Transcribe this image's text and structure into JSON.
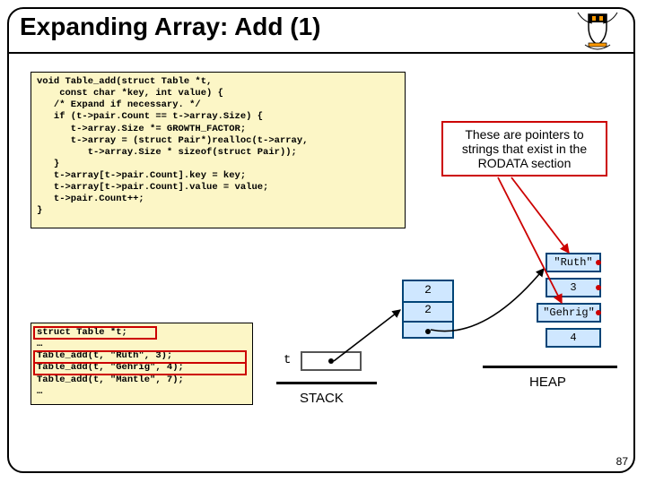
{
  "title": "Expanding Array: Add (1)",
  "code_main": "void Table_add(struct Table *t,\n    const char *key, int value) {\n   /* Expand if necessary. */\n   if (t->pair.Count == t->array.Size) {\n      t->array.Size *= GROWTH_FACTOR;\n      t->array = (struct Pair*)realloc(t->array,\n         t->array.Size * sizeof(struct Pair));\n   }\n   t->array[t->pair.Count].key = key;\n   t->array[t->pair.Count].value = value;\n   t->pair.Count++;\n}",
  "code_calls": "struct Table *t;\n…\nTable_add(t, \"Ruth\", 3);\nTable_add(t, \"Gehrig\", 4);\nTable_add(t, \"Mantle\", 7);\n…",
  "note": "These are pointers to strings that exist in the RODATA section",
  "heap": {
    "ruth": "\"Ruth\"",
    "three": "3",
    "gehrig": "\"Gehrig\"",
    "four": "4",
    "struct_v1": "2",
    "struct_v2": "2"
  },
  "labels": {
    "t": "t",
    "stack": "STACK",
    "heap": "HEAP"
  },
  "page_number": "87"
}
